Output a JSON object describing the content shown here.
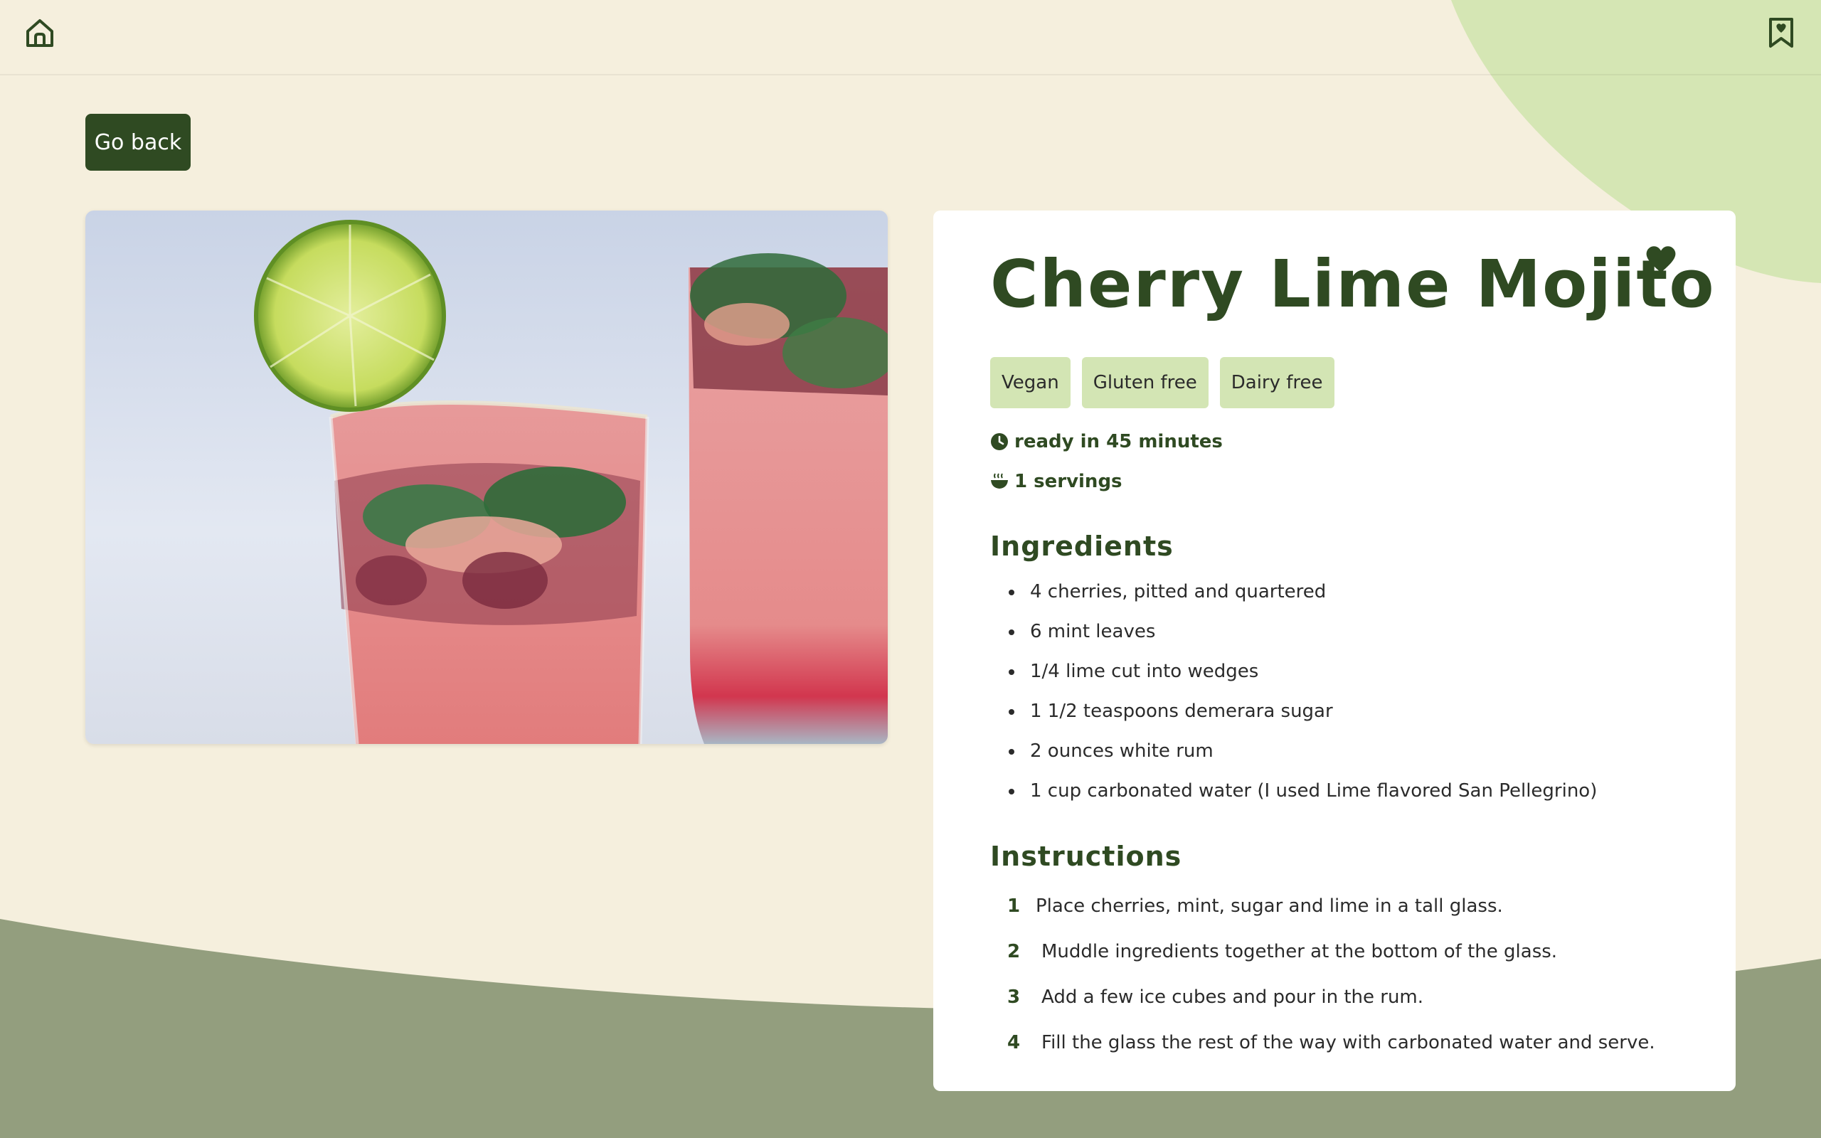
{
  "nav": {
    "home_icon": "home-icon",
    "bookmarks_icon": "bookmark-heart-icon"
  },
  "actions": {
    "go_back_label": "Go back"
  },
  "recipe": {
    "title": "Cherry Lime Mojito",
    "tags": [
      "Vegan",
      "Gluten free",
      "Dairy free"
    ],
    "ready_text": "ready in 45 minutes",
    "servings_text": "1 servings",
    "ingredients_heading": "Ingredients",
    "ingredients": [
      "4 cherries, pitted and quartered",
      "6 mint leaves",
      "1/4 lime cut into wedges",
      "1 1/2 teaspoons demerara sugar",
      "2 ounces white rum",
      "1 cup carbonated water (I used Lime flavored San Pellegrino)"
    ],
    "instructions_heading": "Instructions",
    "instructions": [
      {
        "num": "1",
        "text": "Place cherries, mint, sugar and lime in a tall glass."
      },
      {
        "num": "2",
        "text": "Muddle ingredients together at the bottom of the glass."
      },
      {
        "num": "3",
        "text": "Add a few ice cubes and pour in the rum."
      },
      {
        "num": "4",
        "text": "Fill the glass the rest of the way with carbonated water and serve."
      }
    ]
  },
  "colors": {
    "background": "#f5efdd",
    "accent_dark_green": "#2f4a22",
    "tag_green": "#d3e5b4",
    "blob_light_green": "#d5e6b4",
    "wave_olive": "#939e7e"
  }
}
